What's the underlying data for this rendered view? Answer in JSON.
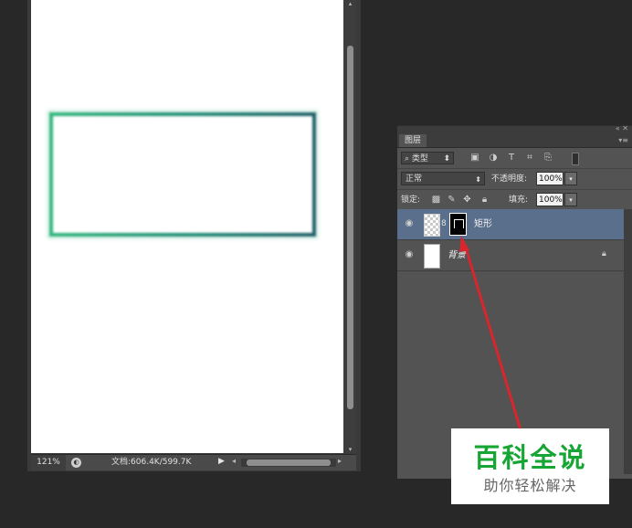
{
  "document": {
    "zoom": "121%",
    "doc_info": "文档:606.4K/599.7K"
  },
  "layers_panel": {
    "tab": "图层",
    "filter": {
      "search_glyph": "⌕",
      "kind": "类型"
    },
    "blend_mode": "正常",
    "opacity_label": "不透明度:",
    "opacity_value": "100%",
    "lock_label": "锁定:",
    "fill_label": "填充:",
    "fill_value": "100%",
    "layers": [
      {
        "name": "矩形",
        "selected": true,
        "visible": true
      },
      {
        "name": "背景",
        "selected": false,
        "visible": true,
        "locked": true
      }
    ]
  },
  "watermark": {
    "title": "百科全说",
    "subtitle": "助你轻松解决"
  },
  "colors": {
    "rect_stroke_start": "#2fb57a",
    "rect_stroke_end": "#1d5f66",
    "selection": "#5a6f8c",
    "arrow": "#d9262c",
    "watermark_green": "#17a534"
  }
}
